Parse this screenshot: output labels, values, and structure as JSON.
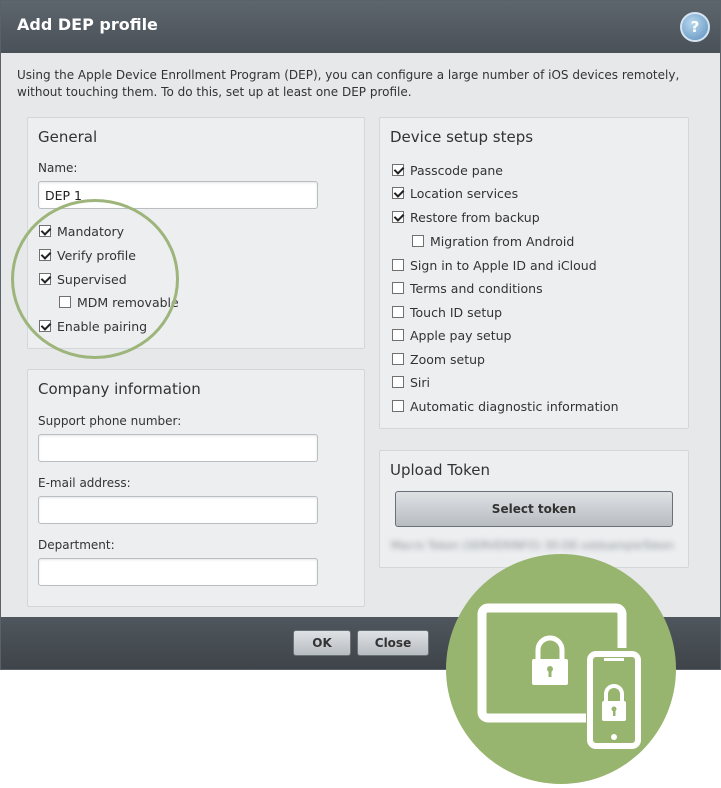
{
  "dialog": {
    "title": "Add DEP profile",
    "help_label": "?",
    "intro": "Using the Apple Device Enrollment Program (DEP), you can configure a large number of iOS devices remotely, without touching them. To do this, set up at least one DEP profile."
  },
  "general": {
    "heading": "General",
    "name_label": "Name:",
    "name_value": "DEP 1",
    "options": [
      {
        "label": "Mandatory",
        "checked": true
      },
      {
        "label": "Verify profile",
        "checked": true
      },
      {
        "label": "Supervised",
        "checked": true
      },
      {
        "label": "MDM removable",
        "checked": false
      },
      {
        "label": "Enable pairing",
        "checked": true
      }
    ]
  },
  "company": {
    "heading": "Company information",
    "phone_label": "Support phone number:",
    "phone_value": "",
    "email_label": "E-mail address:",
    "email_value": "",
    "department_label": "Department:",
    "department_value": ""
  },
  "setup_steps": {
    "heading": "Device setup steps",
    "items": [
      {
        "label": "Passcode pane",
        "checked": true
      },
      {
        "label": "Location services",
        "checked": true
      },
      {
        "label": "Restore from backup",
        "checked": true
      },
      {
        "label": "Migration from Android",
        "checked": false
      },
      {
        "label": "Sign in to Apple ID and iCloud",
        "checked": false
      },
      {
        "label": "Terms and conditions",
        "checked": false
      },
      {
        "label": "Touch ID setup",
        "checked": false
      },
      {
        "label": "Apple pay setup",
        "checked": false
      },
      {
        "label": "Zoom setup",
        "checked": false
      },
      {
        "label": "Siri",
        "checked": false
      },
      {
        "label": "Automatic diagnostic information",
        "checked": false
      }
    ]
  },
  "upload": {
    "heading": "Upload Token",
    "select_label": "Select token",
    "token_text": "Macro Token (SERVERINFO) 30-DE-oddsampleToken"
  },
  "footer": {
    "ok_label": "OK",
    "close_label": "Close"
  },
  "colors": {
    "accent_green": "#98b56f",
    "titlebar": "#555c63"
  },
  "icons": {
    "device_lock_badge": "tablet-phone-lock-icon"
  }
}
